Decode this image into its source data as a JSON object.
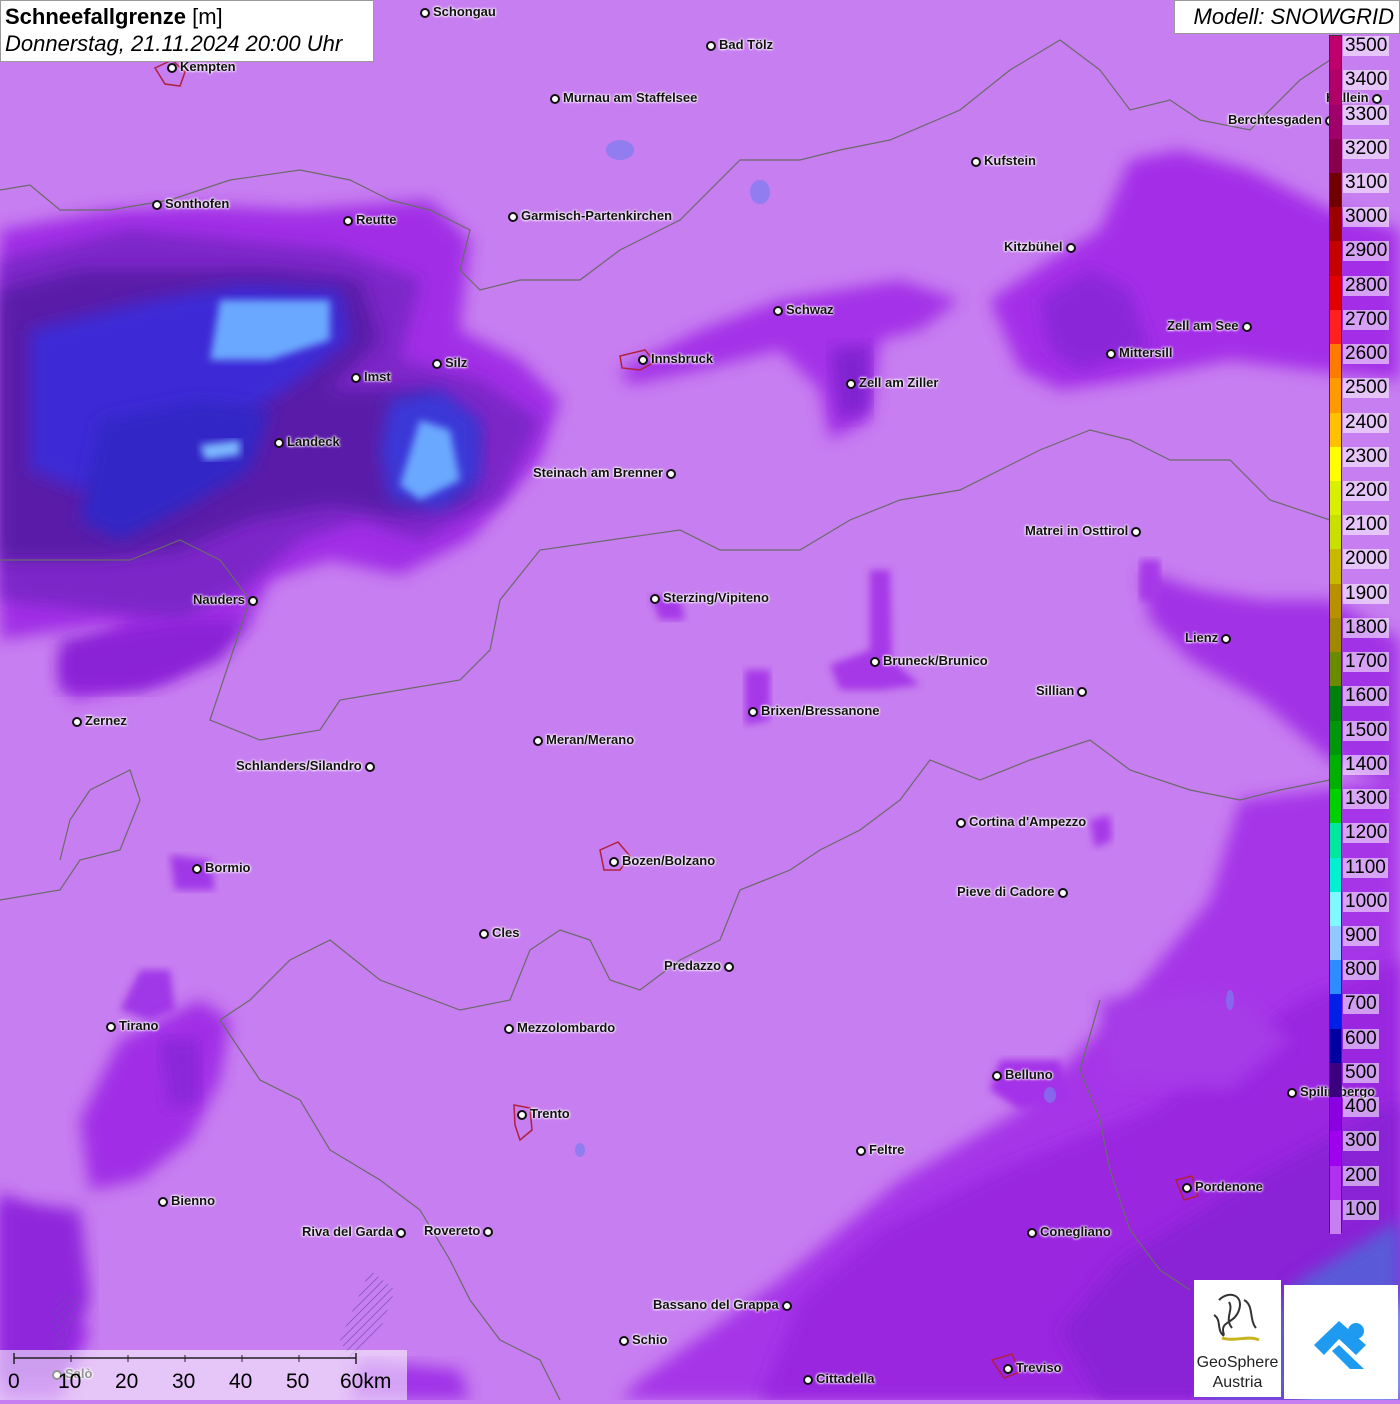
{
  "title": {
    "main": "Schneefallgrenze",
    "unit": "[m]",
    "datetime": "Donnerstag, 21.11.2024 20:00 Uhr"
  },
  "model": "Modell: SNOWGRID",
  "legend": {
    "labels": [
      "3500",
      "3400",
      "3300",
      "3200",
      "3100",
      "3000",
      "2900",
      "2800",
      "2700",
      "2600",
      "2500",
      "2400",
      "2300",
      "2200",
      "2100",
      "2000",
      "1900",
      "1800",
      "1700",
      "1600",
      "1500",
      "1400",
      "1300",
      "1200",
      "1100",
      "1000",
      "900",
      "800",
      "700",
      "600",
      "500",
      "400",
      "300",
      "200",
      "100"
    ],
    "colors": [
      "#c0006a",
      "#b0006a",
      "#a0006a",
      "#88004c",
      "#700000",
      "#9a0000",
      "#c40000",
      "#e00000",
      "#ff2020",
      "#ff7a00",
      "#ff9a00",
      "#ffc000",
      "#ffff00",
      "#d8f000",
      "#c8e000",
      "#c8b800",
      "#b89000",
      "#a08800",
      "#6a8a00",
      "#00800a",
      "#00980a",
      "#00b000",
      "#00d000",
      "#00e8a0",
      "#00f0d0",
      "#80f8ff",
      "#90c8ff",
      "#2e8cff",
      "#0020e8",
      "#0000a0",
      "#3a0080",
      "#8a00e0",
      "#a000f0",
      "#b030f0",
      "#c77ef0"
    ]
  },
  "cities": [
    {
      "name": "Schongau"
    },
    {
      "name": "Bad Tölz"
    },
    {
      "name": "Kempten"
    },
    {
      "name": "Murnau am Staffelsee"
    },
    {
      "name": "Kufstein"
    },
    {
      "name": "Berchtesgaden"
    },
    {
      "name": "Hallein"
    },
    {
      "name": "Sonthofen"
    },
    {
      "name": "Reutte"
    },
    {
      "name": "Garmisch-Partenkirchen"
    },
    {
      "name": "Kitzbühel"
    },
    {
      "name": "Schwaz"
    },
    {
      "name": "Zell am See"
    },
    {
      "name": "Mittersill"
    },
    {
      "name": "Innsbruck"
    },
    {
      "name": "Silz"
    },
    {
      "name": "Imst"
    },
    {
      "name": "Zell am Ziller"
    },
    {
      "name": "Landeck"
    },
    {
      "name": "Steinach am Brenner"
    },
    {
      "name": "Matrei in Osttirol"
    },
    {
      "name": "Nauders"
    },
    {
      "name": "Sterzing/Vipiteno"
    },
    {
      "name": "Lienz"
    },
    {
      "name": "Bruneck/Brunico"
    },
    {
      "name": "Sillian"
    },
    {
      "name": "Brixen/Bressanone"
    },
    {
      "name": "Zernez"
    },
    {
      "name": "Meran/Merano"
    },
    {
      "name": "Schlanders/Silandro"
    },
    {
      "name": "Cortina d'Ampezzo"
    },
    {
      "name": "Bozen/Bolzano"
    },
    {
      "name": "Bormio"
    },
    {
      "name": "Pieve di Cadore"
    },
    {
      "name": "Cles"
    },
    {
      "name": "Predazzo"
    },
    {
      "name": "Tirano"
    },
    {
      "name": "Mezzolombardo"
    },
    {
      "name": "Belluno"
    },
    {
      "name": "Spilimbergo"
    },
    {
      "name": "Trento"
    },
    {
      "name": "Feltre"
    },
    {
      "name": "Pordenone"
    },
    {
      "name": "Bienno"
    },
    {
      "name": "Riva del Garda"
    },
    {
      "name": "Rovereto"
    },
    {
      "name": "Conegliano"
    },
    {
      "name": "Bassano del Grappa"
    },
    {
      "name": "Schio"
    },
    {
      "name": "Treviso"
    },
    {
      "name": "Cittadella"
    },
    {
      "name": "Salò"
    }
  ],
  "scale": {
    "ticks": [
      "0",
      "10",
      "20",
      "30",
      "40",
      "50",
      "60km"
    ]
  },
  "logos": {
    "geosphere_line1": "GeoSphere",
    "geosphere_line2": "Austria"
  }
}
